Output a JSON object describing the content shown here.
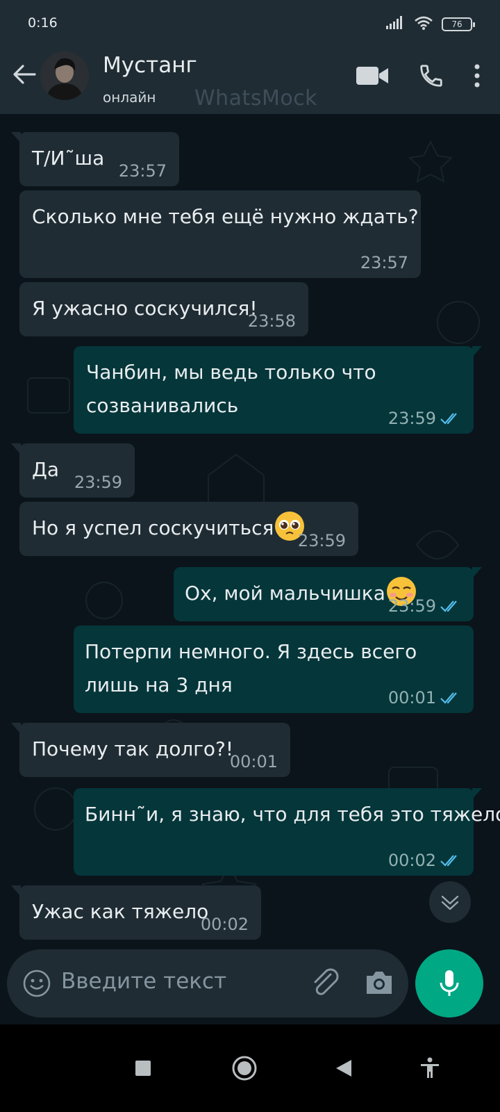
{
  "status_bar": {
    "time": "0:16",
    "battery": "76"
  },
  "header": {
    "name": "Мустанг",
    "status": "онлайн",
    "watermark": "WhatsMock"
  },
  "messages": [
    {
      "dir": "in",
      "text": "Т/И˜ша",
      "time": "23:57"
    },
    {
      "dir": "in",
      "text": "Сколько мне тебя ещё нужно ждать?",
      "time": "23:57"
    },
    {
      "dir": "in",
      "text": "Я ужасно соскучился!",
      "time": "23:58"
    },
    {
      "dir": "out",
      "text": "Чанбин, мы ведь только что созванивались",
      "time": "23:59"
    },
    {
      "dir": "in",
      "text": "Да",
      "time": "23:59"
    },
    {
      "dir": "in",
      "text": "Но я успел соскучиться",
      "time": "23:59",
      "emoji": "pleading-face"
    },
    {
      "dir": "out",
      "text": "Ох, мой мальчишка",
      "time": "23:59",
      "emoji": "smiling-face"
    },
    {
      "dir": "out",
      "text": "Потерпи немного. Я здесь всего лишь на 3 дня",
      "time": "00:01"
    },
    {
      "dir": "in",
      "text": "Почему так долго?!",
      "time": "00:01"
    },
    {
      "dir": "out",
      "text": "Бинн˜и, я знаю, что для тебя это тяжело",
      "time": "00:02"
    },
    {
      "dir": "in",
      "text": "Ужас как тяжело",
      "time": "00:02"
    }
  ],
  "input": {
    "placeholder": "Введите текст"
  },
  "colors": {
    "header_bg": "#1f2c34",
    "incoming_bubble": "#1f2c34",
    "outgoing_bubble": "#04363a",
    "read_ticks": "#53bdeb",
    "mic_button": "#00a884"
  },
  "icons": [
    "back-arrow-icon",
    "video-call-icon",
    "phone-icon",
    "more-vert-icon",
    "double-check-icon",
    "emoji-icon",
    "paperclip-icon",
    "camera-icon",
    "microphone-icon",
    "chevron-down-icon",
    "square-icon",
    "circle-icon",
    "triangle-back-icon",
    "accessibility-icon"
  ]
}
